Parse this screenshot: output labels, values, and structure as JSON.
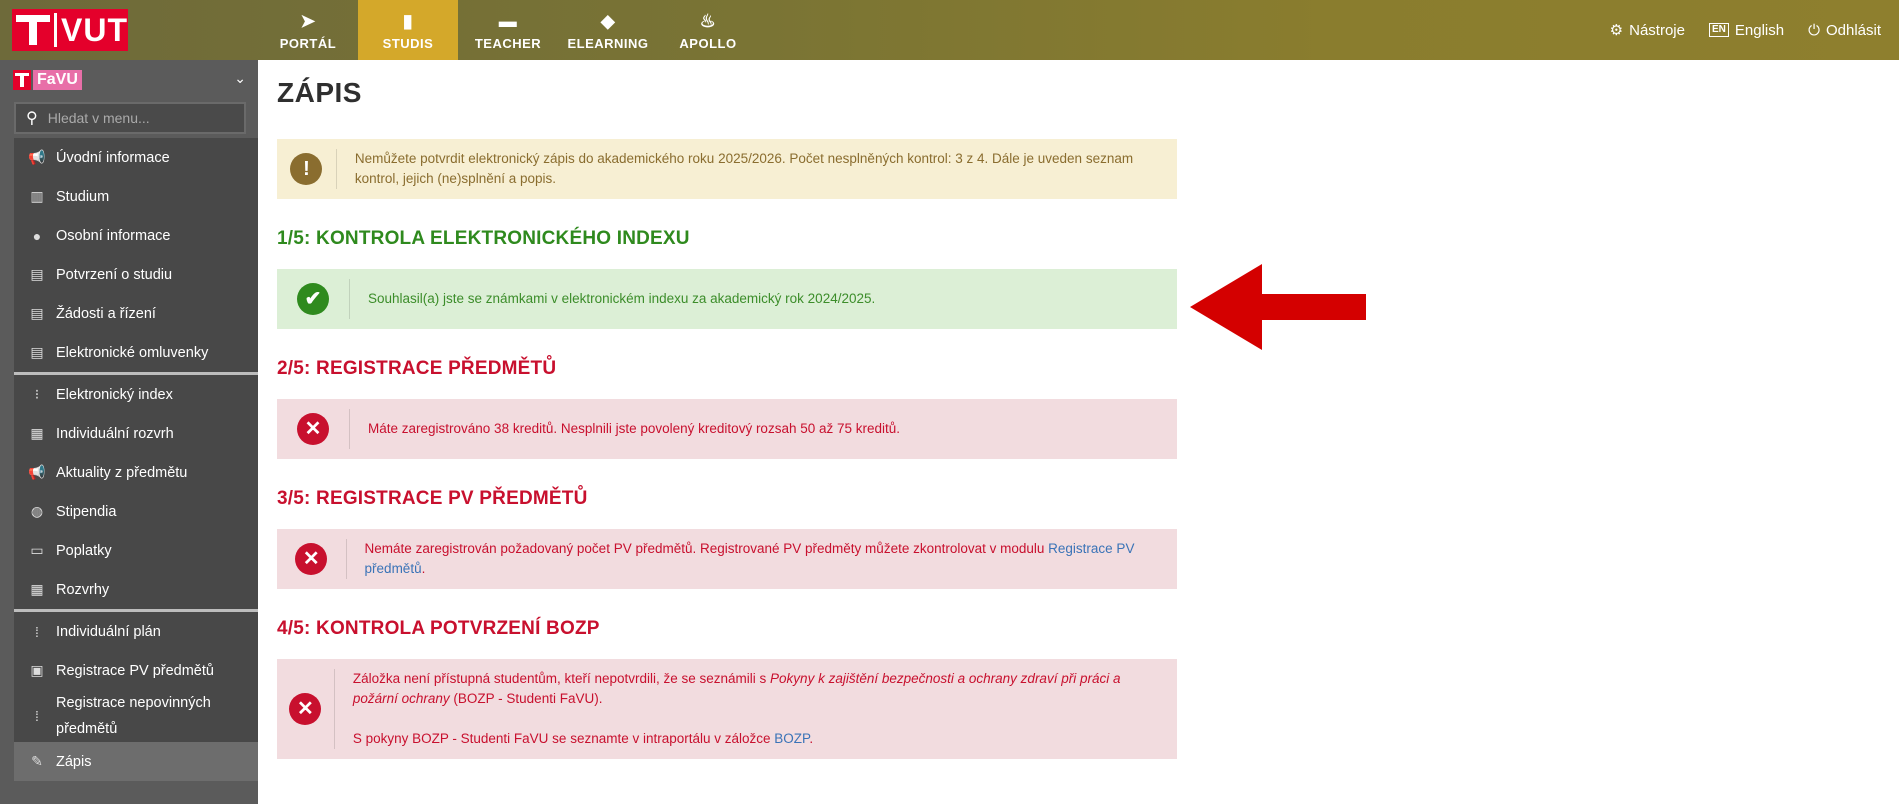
{
  "topbar": {
    "tabs": [
      {
        "label": "PORTÁL",
        "icon": "paper-plane-icon"
      },
      {
        "label": "STUDIS",
        "icon": "book-icon"
      },
      {
        "label": "TEACHER",
        "icon": "briefcase-icon"
      },
      {
        "label": "ELEARNING",
        "icon": "graduation-cap-icon"
      },
      {
        "label": "APOLLO",
        "icon": "flame-icon"
      }
    ],
    "active_tab": "STUDIS",
    "logo_text": "VUT",
    "tools_label": "Nástroje",
    "language_label": "English",
    "logout_label": "Odhlásit"
  },
  "sidebar": {
    "faculty": "FaVU",
    "search_placeholder": "Hledat v menu...",
    "items": [
      {
        "label": "Úvodní informace",
        "icon": "megaphone-icon"
      },
      {
        "label": "Studium",
        "icon": "books-icon"
      },
      {
        "label": "Osobní informace",
        "icon": "person-icon"
      },
      {
        "label": "Potvrzení o studiu",
        "icon": "document-icon"
      },
      {
        "label": "Žádosti a řízení",
        "icon": "document-icon"
      },
      {
        "label": "Elektronické omluvenky",
        "icon": "document-icon"
      },
      {
        "label": "Elektronický index",
        "icon": "index-icon"
      },
      {
        "label": "Individuální rozvrh",
        "icon": "calendar-icon"
      },
      {
        "label": "Aktuality z předmětu",
        "icon": "megaphone-icon"
      },
      {
        "label": "Stipendia",
        "icon": "piggy-bank-icon"
      },
      {
        "label": "Poplatky",
        "icon": "money-icon"
      },
      {
        "label": "Rozvrhy",
        "icon": "calendar-icon"
      },
      {
        "label": "Individuální plán",
        "icon": "plan-icon"
      },
      {
        "label": "Registrace PV předmětů",
        "icon": "clipboard-check-icon"
      },
      {
        "label": "Registrace nepovinných předmětů",
        "icon": "plan-icon"
      },
      {
        "label": "Zápis",
        "icon": "pencil-icon"
      }
    ],
    "active_item": "Zápis"
  },
  "main": {
    "title": "ZÁPIS",
    "warning": "Nemůžete potvrdit elektronický zápis do akademického roku 2025/2026. Počet nesplněných kontrol: 3 z 4. Dále je uveden seznam kontrol, jejich (ne)splnění a popis.",
    "sections": [
      {
        "title": "1/5: KONTROLA ELEKTRONICKÉHO INDEXU",
        "status": "ok",
        "message": "Souhlasil(a) jste se známkami v elektronickém indexu za akademický rok 2024/2025."
      },
      {
        "title": "2/5: REGISTRACE PŘEDMĚTŮ",
        "status": "error",
        "message": "Máte zaregistrováno 38 kreditů. Nesplnili jste povolený kreditový rozsah 50 až 75 kreditů."
      },
      {
        "title": "3/5: REGISTRACE PV PŘEDMĚTŮ",
        "status": "error",
        "message": "Nemáte zaregistrován požadovaný počet PV předmětů. Registrované PV předměty můžete zkontrolovat v modulu ",
        "link": "Registrace PV předmětů",
        "message_end": "."
      },
      {
        "title": "4/5: KONTROLA POTVRZENÍ BOZP",
        "status": "error",
        "message_a": "Záložka není přístupná studentům, kteří nepotvrdili, že se seznámili s ",
        "message_em": "Pokyny k zajištění bezpečnosti a ochrany zdraví při práci a požární ochrany",
        "message_b": " (BOZP - Studenti FaVU).",
        "message_c": "S pokyny BOZP - Studenti FaVU se seznamte v intraportálu v záložce ",
        "link": "BOZP",
        "message_end": "."
      }
    ]
  },
  "colors": {
    "ok": "#2f8a1e",
    "error": "#c8102e",
    "warning": "#8a6d2f",
    "brand": "#e4002b",
    "arrow": "#d40000"
  }
}
